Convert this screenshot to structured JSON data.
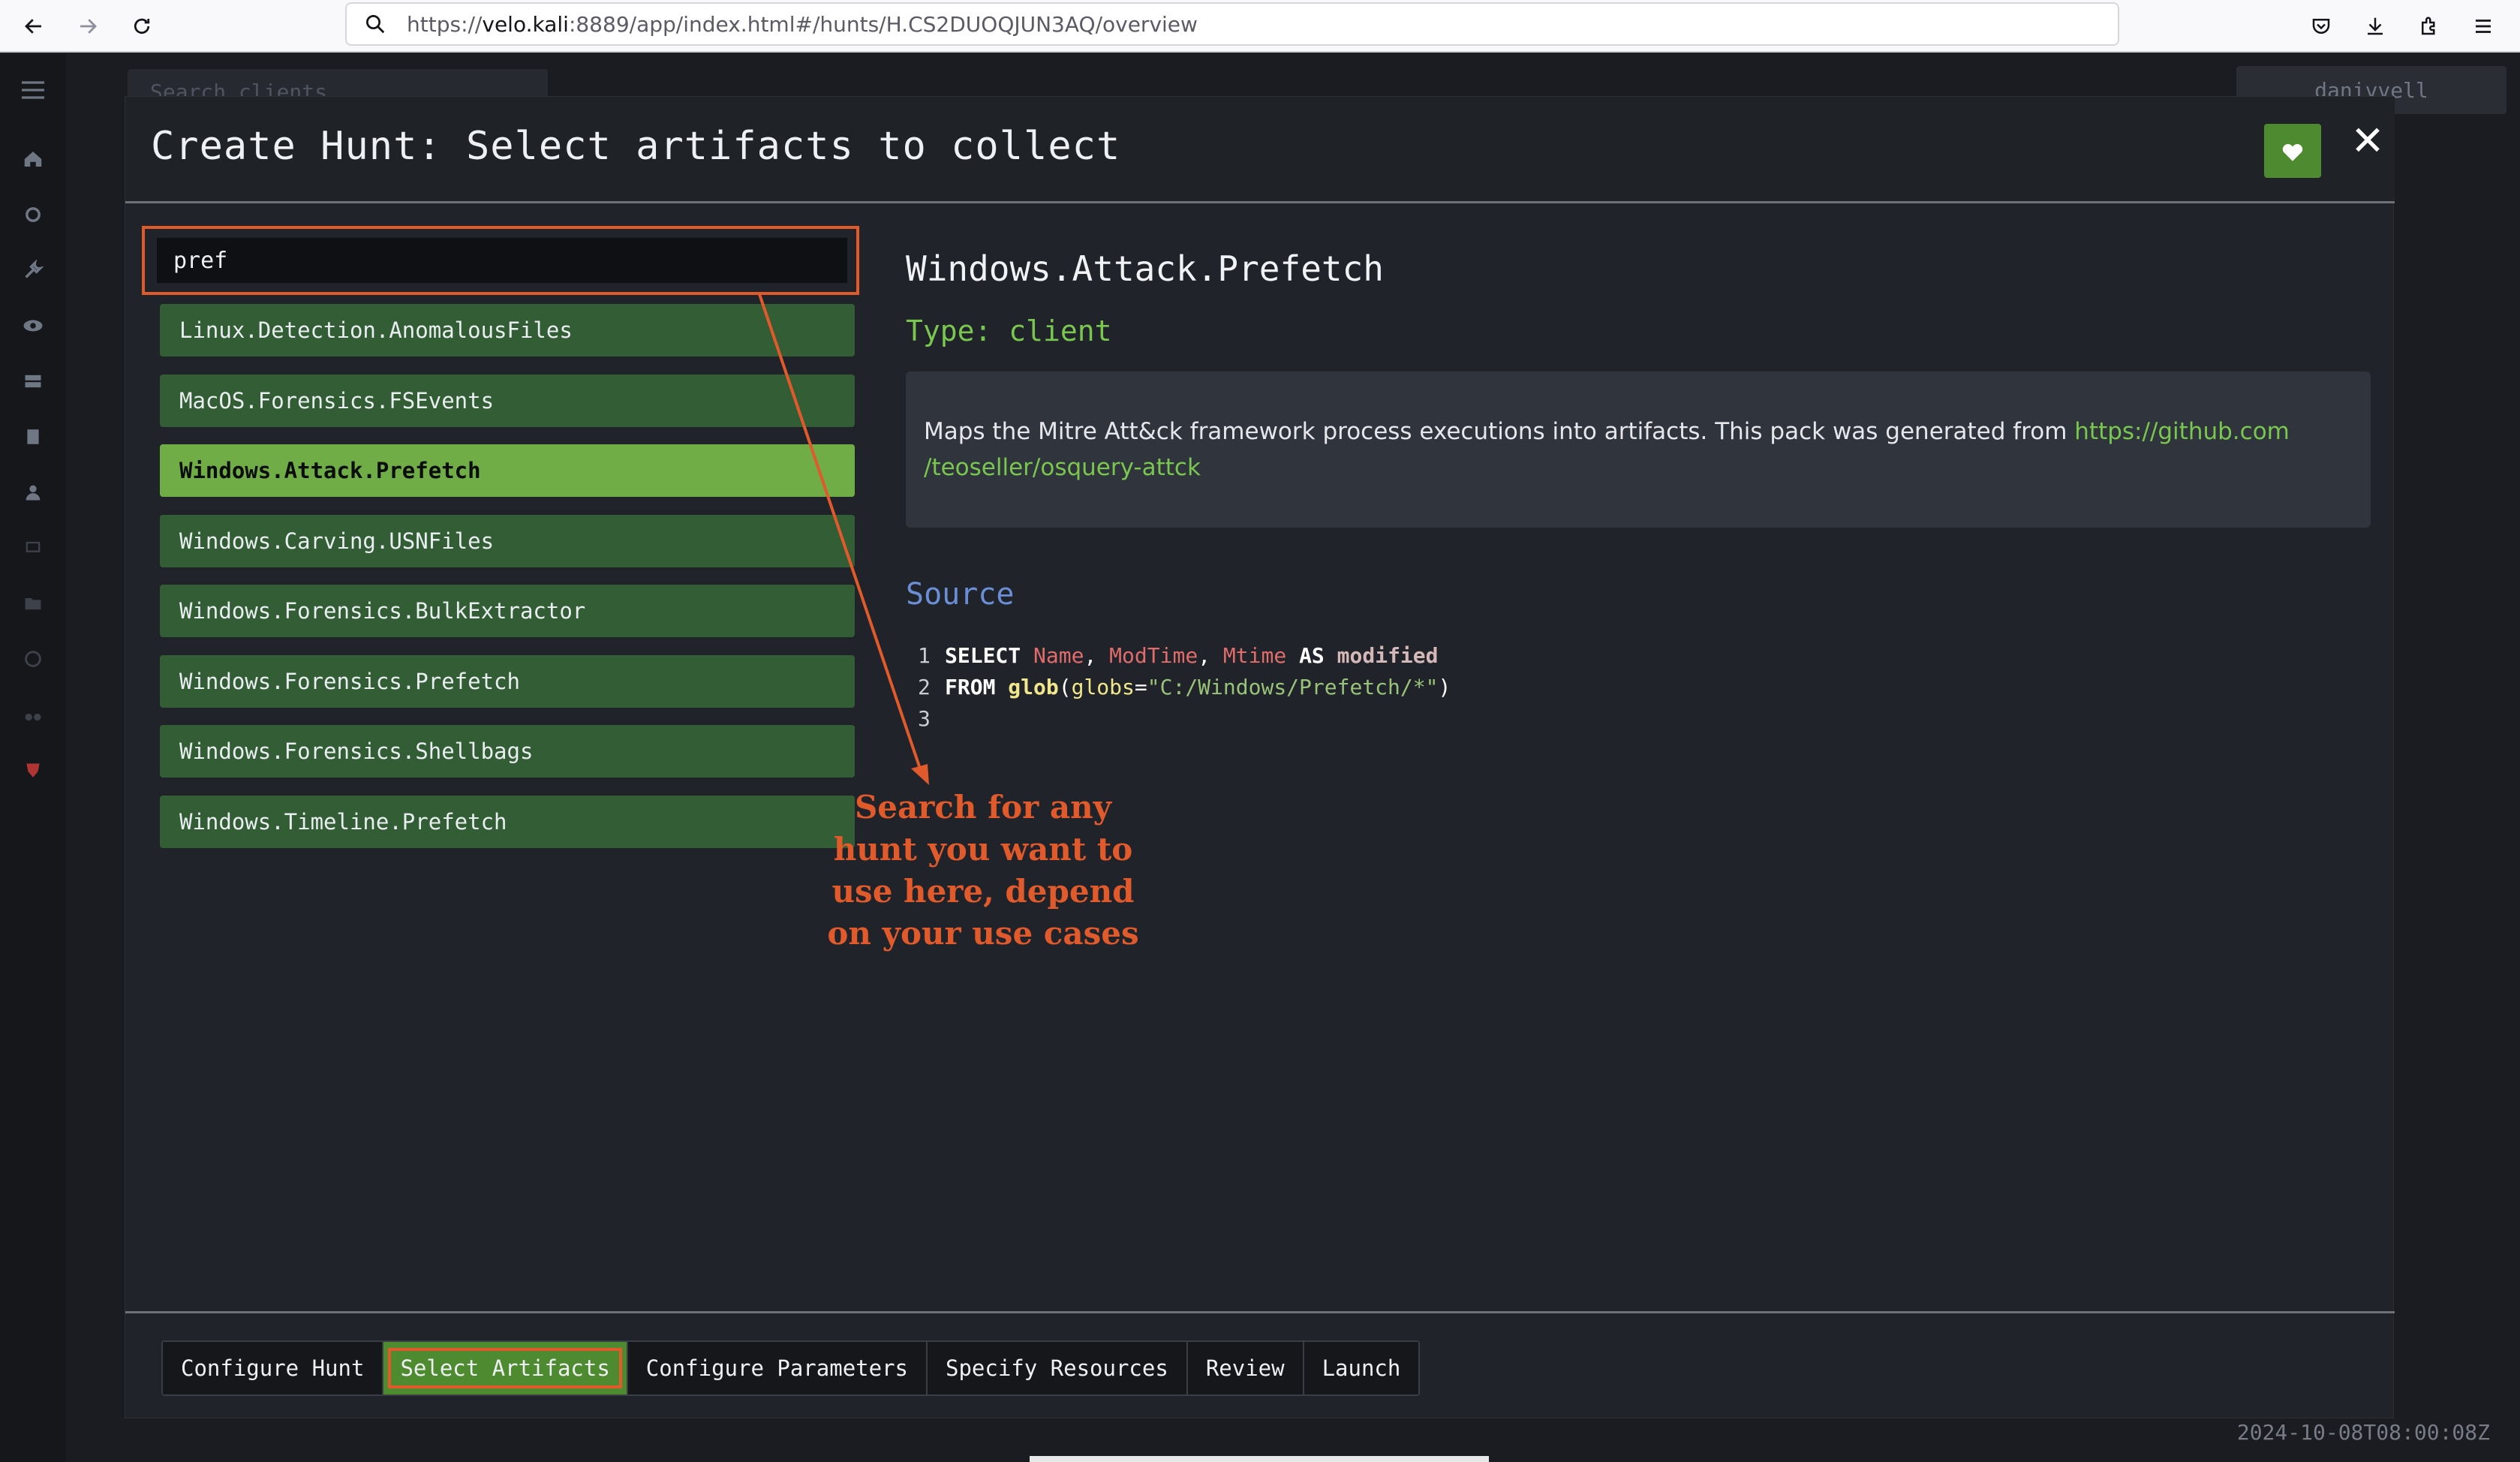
{
  "browser": {
    "url_prefix": "https://",
    "url_host": "velo.kali",
    "url_rest": ":8889/app/index.html#/hunts/H.CS2DUOQJUN3AQ/overview"
  },
  "background": {
    "search_placeholder": "Search clients",
    "username": "danivvell",
    "timestamp": "2024-10-08T08:00:08Z"
  },
  "modal": {
    "title": "Create Hunt: Select artifacts to collect",
    "search_value": "pref",
    "artifacts": [
      "Linux.Detection.AnomalousFiles",
      "MacOS.Forensics.FSEvents",
      "Windows.Attack.Prefetch",
      "Windows.Carving.USNFiles",
      "Windows.Forensics.BulkExtractor",
      "Windows.Forensics.Prefetch",
      "Windows.Forensics.Shellbags",
      "Windows.Timeline.Prefetch"
    ],
    "selected_artifact": "Windows.Attack.Prefetch",
    "detail": {
      "name": "Windows.Attack.Prefetch",
      "type_label": "Type: client",
      "description": "Maps the Mitre Att&ck framework process executions into artifacts. This pack was generated from ",
      "link_text_1": "https://github.com",
      "link_text_2": "/teoseller/osquery-attck",
      "source_heading": "Source",
      "code_lines": [
        "SELECT Name, ModTime, Mtime AS modified",
        "FROM glob(globs=\"C:/Windows/Prefetch/*\")",
        ""
      ]
    },
    "annotation": "Search for any hunt you want to use here, depend on your use cases",
    "wizard_tabs": [
      "Configure Hunt",
      "Select Artifacts",
      "Configure Parameters",
      "Specify Resources",
      "Review",
      "Launch"
    ],
    "active_tab": "Select Artifacts"
  },
  "colors": {
    "accent_green": "#70ad47",
    "item_green": "#335d35",
    "annotation_orange": "#e05a2b",
    "link_green": "#7ac74f"
  }
}
